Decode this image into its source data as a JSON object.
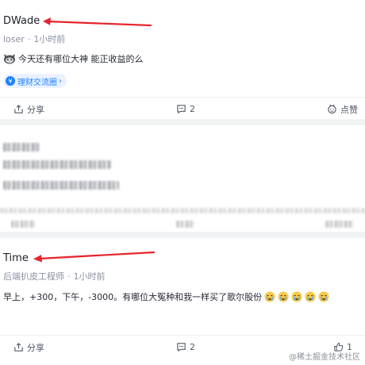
{
  "posts": [
    {
      "author": "DWade",
      "title_role": "loser",
      "time": "1小时前",
      "content": "今天还有哪位大神 能正收益的么",
      "tag": "理财交流圈",
      "share_label": "分享",
      "comment_count": "2",
      "like_label": "点赞"
    },
    {
      "author": "Time",
      "title_role": "后端扒皮工程师",
      "time": "1小时前",
      "content": "早上，+300，下午，-3000。有哪位大冤种和我一样买了歌尔股份",
      "share_label": "分享",
      "comment_count": "2",
      "like_count": "1"
    }
  ],
  "separator_dot": "·",
  "watermark": "@稀土掘金技术社区",
  "colors": {
    "accent": "#1e80ff",
    "annotation_arrow": "#e5242b",
    "muted": "#8a919f",
    "divider": "#f2f3f5"
  },
  "icons": {
    "share": "share-icon",
    "comment": "comment-icon",
    "like": "thumbs-up-icon",
    "cat": "cat-emoji-icon",
    "cry": "crying-face-emoji-icon"
  }
}
